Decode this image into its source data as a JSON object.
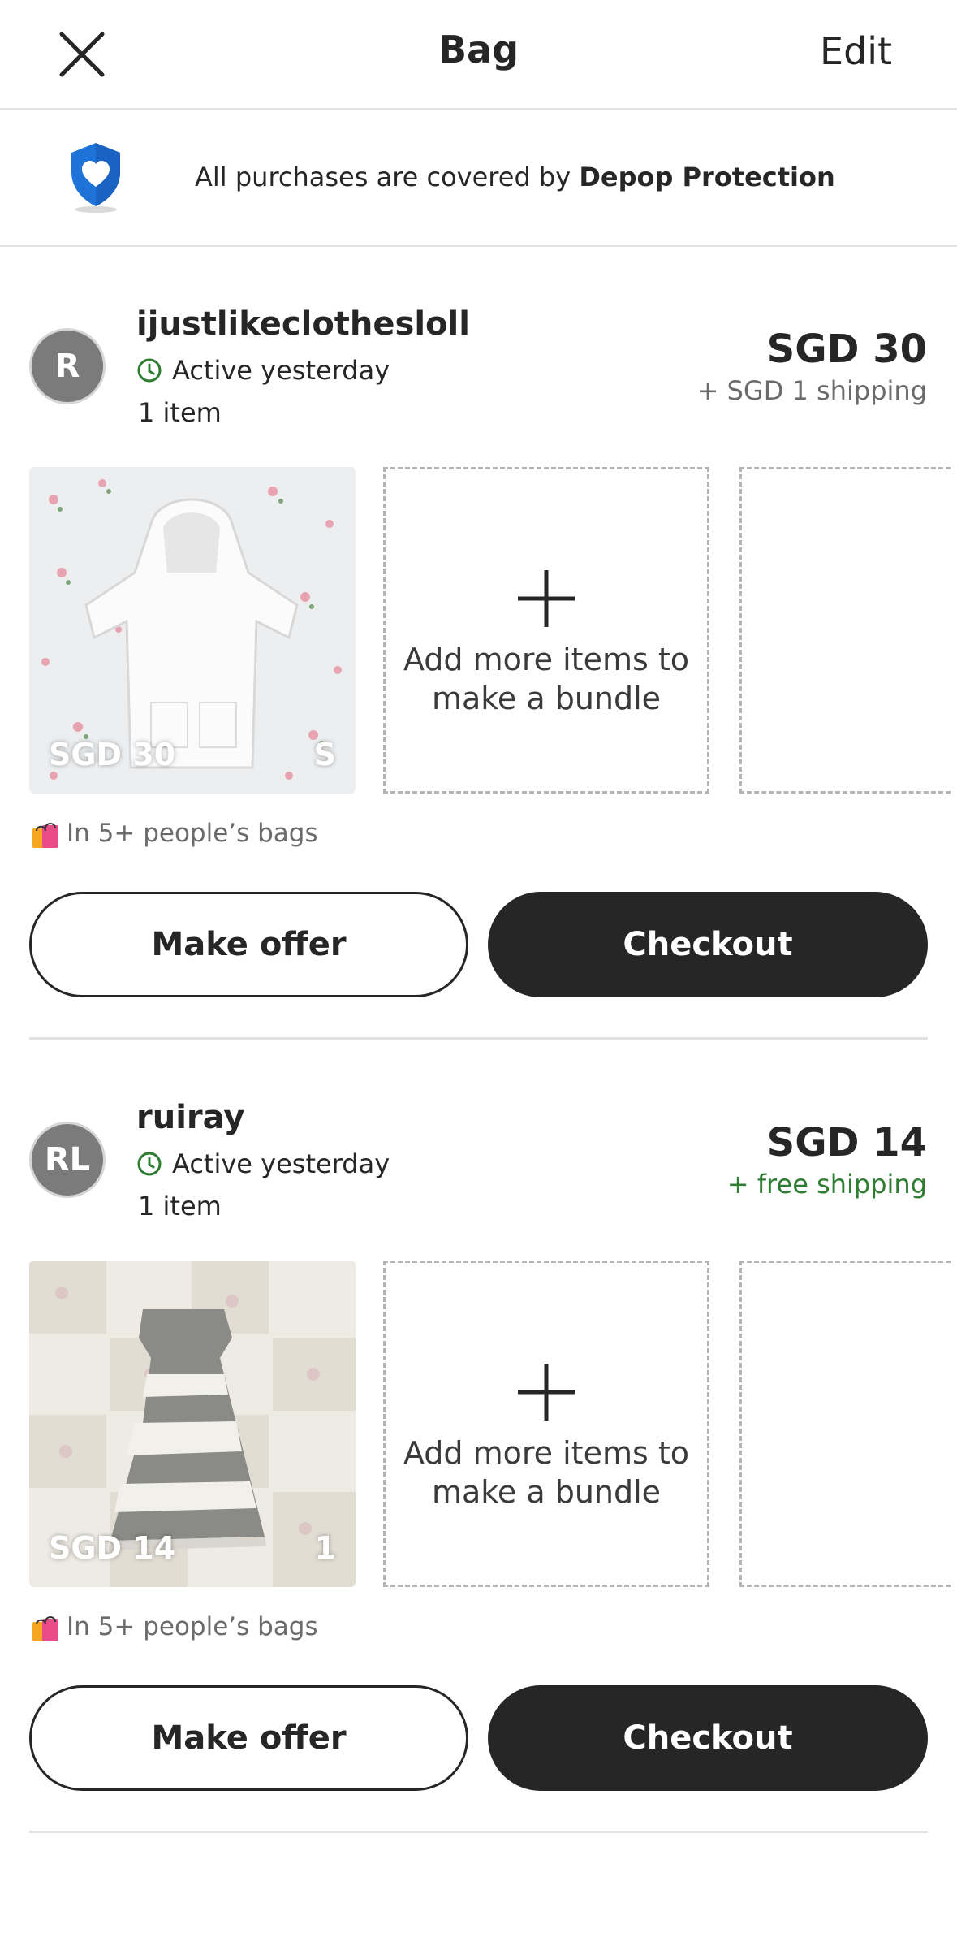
{
  "header": {
    "title": "Bag",
    "edit_label": "Edit"
  },
  "banner": {
    "text_prefix": "All purchases are covered by ",
    "text_bold": "Depop Protection"
  },
  "colors": {
    "primary": "#262626",
    "active_green": "#2e7d32",
    "shield_blue": "#1e73d8",
    "muted": "#6b6b6b"
  },
  "sellers": [
    {
      "avatar_initials": "R",
      "name": "ijustlikeclothesloll",
      "status": "Active yesterday",
      "item_count": "1 item",
      "price": "SGD 30",
      "shipping": "+ SGD 1 shipping",
      "photo_price": "SGD 30",
      "photo_size": "S",
      "add_more": "Add more items to make a bundle",
      "bags_note": "In 5+ people’s bags",
      "offer_label": "Make offer",
      "checkout_label": "Checkout"
    },
    {
      "avatar_initials": "RL",
      "name": "ruiray",
      "status": "Active yesterday",
      "item_count": "1 item",
      "price": "SGD 14",
      "shipping": "+ free shipping",
      "photo_price": "SGD 14",
      "photo_size": "1",
      "add_more": "Add more items to make a bundle",
      "bags_note": "In 5+ people’s bags",
      "offer_label": "Make offer",
      "checkout_label": "Checkout"
    }
  ]
}
